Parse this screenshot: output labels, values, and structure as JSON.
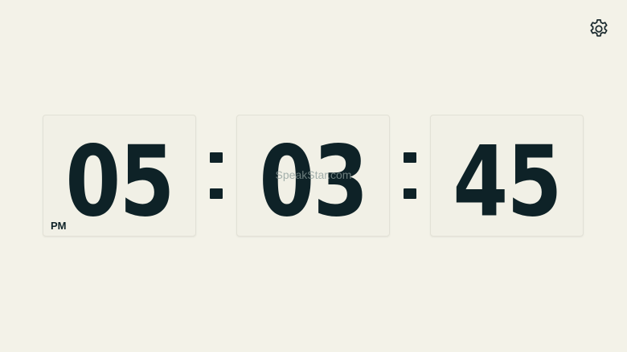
{
  "clock": {
    "hours": "05",
    "minutes": "03",
    "seconds": "45",
    "period": "PM",
    "watermark": "SpeakStar.com"
  },
  "colors": {
    "background": "#f3f2e8",
    "digit": "#0e2227",
    "card_border": "#e2e1d6"
  },
  "icons": {
    "settings": "gear-icon"
  }
}
